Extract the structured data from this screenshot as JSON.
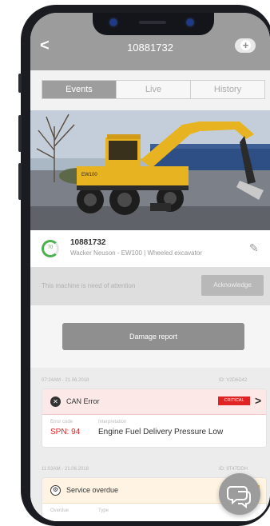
{
  "header": {
    "title": "10881732",
    "back_glyph": "<",
    "add_icon": "plus-icon",
    "add_glyph": "+"
  },
  "tabs": [
    {
      "label": "Events",
      "active": true
    },
    {
      "label": "Live",
      "active": false
    },
    {
      "label": "History",
      "active": false
    }
  ],
  "machine": {
    "id": "10881732",
    "description": "Wacker Neuson - EW100 | Wheeled excavator",
    "gauge_value": "70",
    "gauge_fraction": 0.7,
    "edit_icon": "pencil-icon",
    "edit_glyph": "✎"
  },
  "attention": {
    "message": "This machine is need of attention",
    "button": "Acknowledge"
  },
  "damage_button": "Damage report",
  "events": [
    {
      "time": "07:24AM - 21.06.2018",
      "event_id": "ID: V2D6D42",
      "title": "CAN Error",
      "badge": "CRITICAL",
      "icon": "x-circle-icon",
      "error_code_label": "Error code",
      "error_code": "SPN: 94",
      "interpretation_label": "Interpretation",
      "interpretation": "Engine Fuel Delivery Pressure Low"
    },
    {
      "time": "11:03AM - 21.06.2018",
      "event_id": "ID: 9T47DDH",
      "title": "Service overdue",
      "icon": "wrench-icon",
      "overdue_label": "Overdue",
      "type_label": "Type"
    }
  ],
  "colors": {
    "header": "#9c9c9c",
    "critical": "#e02424",
    "gauge": "#4caf50",
    "warning": "#f2b233"
  },
  "chat_icon": "chat-bubble-icon"
}
